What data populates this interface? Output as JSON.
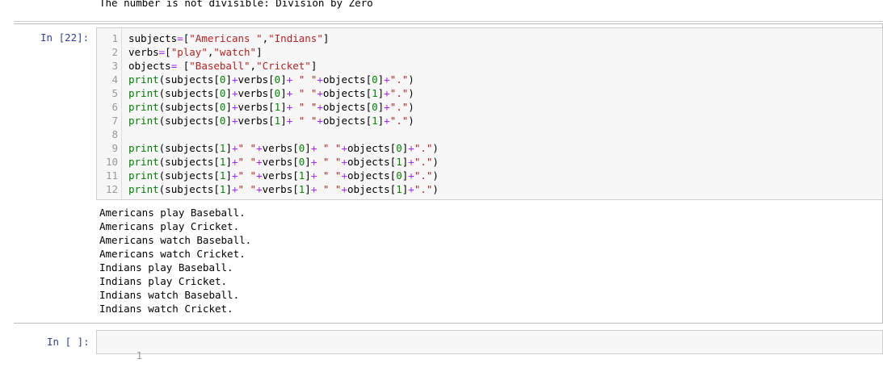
{
  "previous_output": "The number is not divisible: Division by Zero",
  "cell": {
    "prompt": "In [22]:",
    "line_numbers": [
      "1",
      "2",
      "3",
      "4",
      "5",
      "6",
      "7",
      "8",
      "9",
      "10",
      "11",
      "12"
    ],
    "code_lines": [
      [
        [
          "tok-var",
          "subjects"
        ],
        [
          "tok-op",
          "="
        ],
        [
          "tok-p",
          "["
        ],
        [
          "tok-str",
          "\"Americans \""
        ],
        [
          "tok-p",
          ","
        ],
        [
          "tok-str",
          "\"Indians\""
        ],
        [
          "tok-p",
          "]"
        ]
      ],
      [
        [
          "tok-var",
          "verbs"
        ],
        [
          "tok-op",
          "="
        ],
        [
          "tok-p",
          "["
        ],
        [
          "tok-str",
          "\"play\""
        ],
        [
          "tok-p",
          ","
        ],
        [
          "tok-str",
          "\"watch\""
        ],
        [
          "tok-p",
          "]"
        ]
      ],
      [
        [
          "tok-var",
          "objects"
        ],
        [
          "tok-op",
          "="
        ],
        [
          "tok-p",
          " ["
        ],
        [
          "tok-str",
          "\"Baseball\""
        ],
        [
          "tok-p",
          ","
        ],
        [
          "tok-str",
          "\"Cricket\""
        ],
        [
          "tok-p",
          "]"
        ]
      ],
      [
        [
          "tok-bi",
          "print"
        ],
        [
          "tok-p",
          "(subjects["
        ],
        [
          "tok-num",
          "0"
        ],
        [
          "tok-p",
          "]"
        ],
        [
          "tok-op",
          "+"
        ],
        [
          "tok-p",
          "verbs["
        ],
        [
          "tok-num",
          "0"
        ],
        [
          "tok-p",
          "]"
        ],
        [
          "tok-op",
          "+"
        ],
        [
          "tok-str",
          " \" \""
        ],
        [
          "tok-op",
          "+"
        ],
        [
          "tok-p",
          "objects["
        ],
        [
          "tok-num",
          "0"
        ],
        [
          "tok-p",
          "]"
        ],
        [
          "tok-op",
          "+"
        ],
        [
          "tok-str",
          "\".\""
        ],
        [
          "tok-p",
          ")"
        ]
      ],
      [
        [
          "tok-bi",
          "print"
        ],
        [
          "tok-p",
          "(subjects["
        ],
        [
          "tok-num",
          "0"
        ],
        [
          "tok-p",
          "]"
        ],
        [
          "tok-op",
          "+"
        ],
        [
          "tok-p",
          "verbs["
        ],
        [
          "tok-num",
          "0"
        ],
        [
          "tok-p",
          "]"
        ],
        [
          "tok-op",
          "+"
        ],
        [
          "tok-str",
          " \" \""
        ],
        [
          "tok-op",
          "+"
        ],
        [
          "tok-p",
          "objects["
        ],
        [
          "tok-num",
          "1"
        ],
        [
          "tok-p",
          "]"
        ],
        [
          "tok-op",
          "+"
        ],
        [
          "tok-str",
          "\".\""
        ],
        [
          "tok-p",
          ")"
        ]
      ],
      [
        [
          "tok-bi",
          "print"
        ],
        [
          "tok-p",
          "(subjects["
        ],
        [
          "tok-num",
          "0"
        ],
        [
          "tok-p",
          "]"
        ],
        [
          "tok-op",
          "+"
        ],
        [
          "tok-p",
          "verbs["
        ],
        [
          "tok-num",
          "1"
        ],
        [
          "tok-p",
          "]"
        ],
        [
          "tok-op",
          "+"
        ],
        [
          "tok-str",
          " \" \""
        ],
        [
          "tok-op",
          "+"
        ],
        [
          "tok-p",
          "objects["
        ],
        [
          "tok-num",
          "0"
        ],
        [
          "tok-p",
          "]"
        ],
        [
          "tok-op",
          "+"
        ],
        [
          "tok-str",
          "\".\""
        ],
        [
          "tok-p",
          ")"
        ]
      ],
      [
        [
          "tok-bi",
          "print"
        ],
        [
          "tok-p",
          "(subjects["
        ],
        [
          "tok-num",
          "0"
        ],
        [
          "tok-p",
          "]"
        ],
        [
          "tok-op",
          "+"
        ],
        [
          "tok-p",
          "verbs["
        ],
        [
          "tok-num",
          "1"
        ],
        [
          "tok-p",
          "]"
        ],
        [
          "tok-op",
          "+"
        ],
        [
          "tok-str",
          " \" \""
        ],
        [
          "tok-op",
          "+"
        ],
        [
          "tok-p",
          "objects["
        ],
        [
          "tok-num",
          "1"
        ],
        [
          "tok-p",
          "]"
        ],
        [
          "tok-op",
          "+"
        ],
        [
          "tok-str",
          "\".\""
        ],
        [
          "tok-p",
          ")"
        ]
      ],
      [],
      [
        [
          "tok-bi",
          "print"
        ],
        [
          "tok-p",
          "(subjects["
        ],
        [
          "tok-num",
          "1"
        ],
        [
          "tok-p",
          "]"
        ],
        [
          "tok-op",
          "+"
        ],
        [
          "tok-str",
          "\" \""
        ],
        [
          "tok-op",
          "+"
        ],
        [
          "tok-p",
          "verbs["
        ],
        [
          "tok-num",
          "0"
        ],
        [
          "tok-p",
          "]"
        ],
        [
          "tok-op",
          "+"
        ],
        [
          "tok-str",
          " \" \""
        ],
        [
          "tok-op",
          "+"
        ],
        [
          "tok-p",
          "objects["
        ],
        [
          "tok-num",
          "0"
        ],
        [
          "tok-p",
          "]"
        ],
        [
          "tok-op",
          "+"
        ],
        [
          "tok-str",
          "\".\""
        ],
        [
          "tok-p",
          ")"
        ]
      ],
      [
        [
          "tok-bi",
          "print"
        ],
        [
          "tok-p",
          "(subjects["
        ],
        [
          "tok-num",
          "1"
        ],
        [
          "tok-p",
          "]"
        ],
        [
          "tok-op",
          "+"
        ],
        [
          "tok-str",
          "\" \""
        ],
        [
          "tok-op",
          "+"
        ],
        [
          "tok-p",
          "verbs["
        ],
        [
          "tok-num",
          "0"
        ],
        [
          "tok-p",
          "]"
        ],
        [
          "tok-op",
          "+"
        ],
        [
          "tok-str",
          " \" \""
        ],
        [
          "tok-op",
          "+"
        ],
        [
          "tok-p",
          "objects["
        ],
        [
          "tok-num",
          "1"
        ],
        [
          "tok-p",
          "]"
        ],
        [
          "tok-op",
          "+"
        ],
        [
          "tok-str",
          "\".\""
        ],
        [
          "tok-p",
          ")"
        ]
      ],
      [
        [
          "tok-bi",
          "print"
        ],
        [
          "tok-p",
          "(subjects["
        ],
        [
          "tok-num",
          "1"
        ],
        [
          "tok-p",
          "]"
        ],
        [
          "tok-op",
          "+"
        ],
        [
          "tok-str",
          "\" \""
        ],
        [
          "tok-op",
          "+"
        ],
        [
          "tok-p",
          "verbs["
        ],
        [
          "tok-num",
          "1"
        ],
        [
          "tok-p",
          "]"
        ],
        [
          "tok-op",
          "+"
        ],
        [
          "tok-str",
          " \" \""
        ],
        [
          "tok-op",
          "+"
        ],
        [
          "tok-p",
          "objects["
        ],
        [
          "tok-num",
          "0"
        ],
        [
          "tok-p",
          "]"
        ],
        [
          "tok-op",
          "+"
        ],
        [
          "tok-str",
          "\".\""
        ],
        [
          "tok-p",
          ")"
        ]
      ],
      [
        [
          "tok-bi",
          "print"
        ],
        [
          "tok-p",
          "(subjects["
        ],
        [
          "tok-num",
          "1"
        ],
        [
          "tok-p",
          "]"
        ],
        [
          "tok-op",
          "+"
        ],
        [
          "tok-str",
          "\" \""
        ],
        [
          "tok-op",
          "+"
        ],
        [
          "tok-p",
          "verbs["
        ],
        [
          "tok-num",
          "1"
        ],
        [
          "tok-p",
          "]"
        ],
        [
          "tok-op",
          "+"
        ],
        [
          "tok-str",
          " \" \""
        ],
        [
          "tok-op",
          "+"
        ],
        [
          "tok-p",
          "objects["
        ],
        [
          "tok-num",
          "1"
        ],
        [
          "tok-p",
          "]"
        ],
        [
          "tok-op",
          "+"
        ],
        [
          "tok-str",
          "\".\""
        ],
        [
          "tok-p",
          ")"
        ]
      ]
    ],
    "output_lines": [
      "Americans play Baseball.",
      "Americans play Cricket.",
      "Americans watch Baseball.",
      "Americans watch Cricket.",
      "Indians play Baseball.",
      "Indians play Cricket.",
      "Indians watch Baseball.",
      "Indians watch Cricket."
    ]
  },
  "next_cell": {
    "prompt": "In [ ]:",
    "line_number": "1"
  },
  "colors": {
    "selected_bar": "#42a5f5",
    "prompt": "#303f9f",
    "string": "#ba2121",
    "number": "#008800",
    "operator": "#aa22ff",
    "builtin": "#008000"
  }
}
